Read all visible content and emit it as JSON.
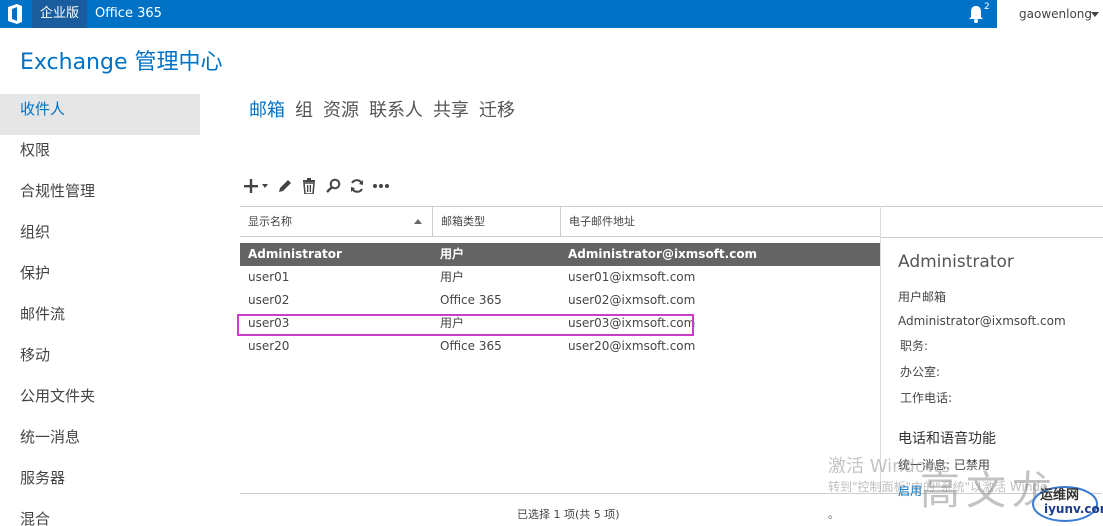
{
  "topbar": {
    "nav1": "企业版",
    "nav2": "Office 365",
    "notification_count": "2",
    "username": "gaowenlong"
  },
  "app_title": "Exchange 管理中心",
  "sidebar": {
    "items": [
      {
        "label": "收件人"
      },
      {
        "label": "权限"
      },
      {
        "label": "合规性管理"
      },
      {
        "label": "组织"
      },
      {
        "label": "保护"
      },
      {
        "label": "邮件流"
      },
      {
        "label": "移动"
      },
      {
        "label": "公用文件夹"
      },
      {
        "label": "统一消息"
      },
      {
        "label": "服务器"
      },
      {
        "label": "混合"
      }
    ]
  },
  "tabs": [
    {
      "label": "邮箱"
    },
    {
      "label": "组"
    },
    {
      "label": "资源"
    },
    {
      "label": "联系人"
    },
    {
      "label": "共享"
    },
    {
      "label": "迁移"
    }
  ],
  "toolbar": {
    "icons": [
      "add-icon",
      "edit-icon",
      "delete-icon",
      "search-icon",
      "refresh-icon",
      "more-icon"
    ]
  },
  "grid": {
    "columns": [
      "显示名称",
      "邮箱类型",
      "电子邮件地址"
    ],
    "rows": [
      {
        "name": "Administrator",
        "type": "用户",
        "email": "Administrator@ixmsoft.com"
      },
      {
        "name": "user01",
        "type": "用户",
        "email": "user01@ixmsoft.com"
      },
      {
        "name": "user02",
        "type": "Office 365",
        "email": "user02@ixmsoft.com"
      },
      {
        "name": "user03",
        "type": "用户",
        "email": "user03@ixmsoft.com"
      },
      {
        "name": "user20",
        "type": "Office 365",
        "email": "user20@ixmsoft.com"
      }
    ]
  },
  "details": {
    "name": "Administrator",
    "mailbox_type": "用户邮箱",
    "email": "Administrator@ixmsoft.com",
    "title_label": "职务:",
    "office_label": "办公室:",
    "work_phone_label": "工作电话:",
    "section": "电话和语音功能",
    "um_label": "统一消息: 已禁用",
    "enable_link": "启用"
  },
  "status": "已选择 1 项(共 5 项)",
  "status_dot": "。",
  "watermark": {
    "line1": "激活 Windows",
    "line2": "转到\"控制面板\"中的\"系统\"以激活 Windo",
    "cn": "高文龙",
    "logo1": "运维网",
    "logo2": "iyunv.com"
  },
  "colors": {
    "accent": "#0072c6",
    "selected_row": "#646464",
    "highlight_box": "#c93ec9"
  }
}
